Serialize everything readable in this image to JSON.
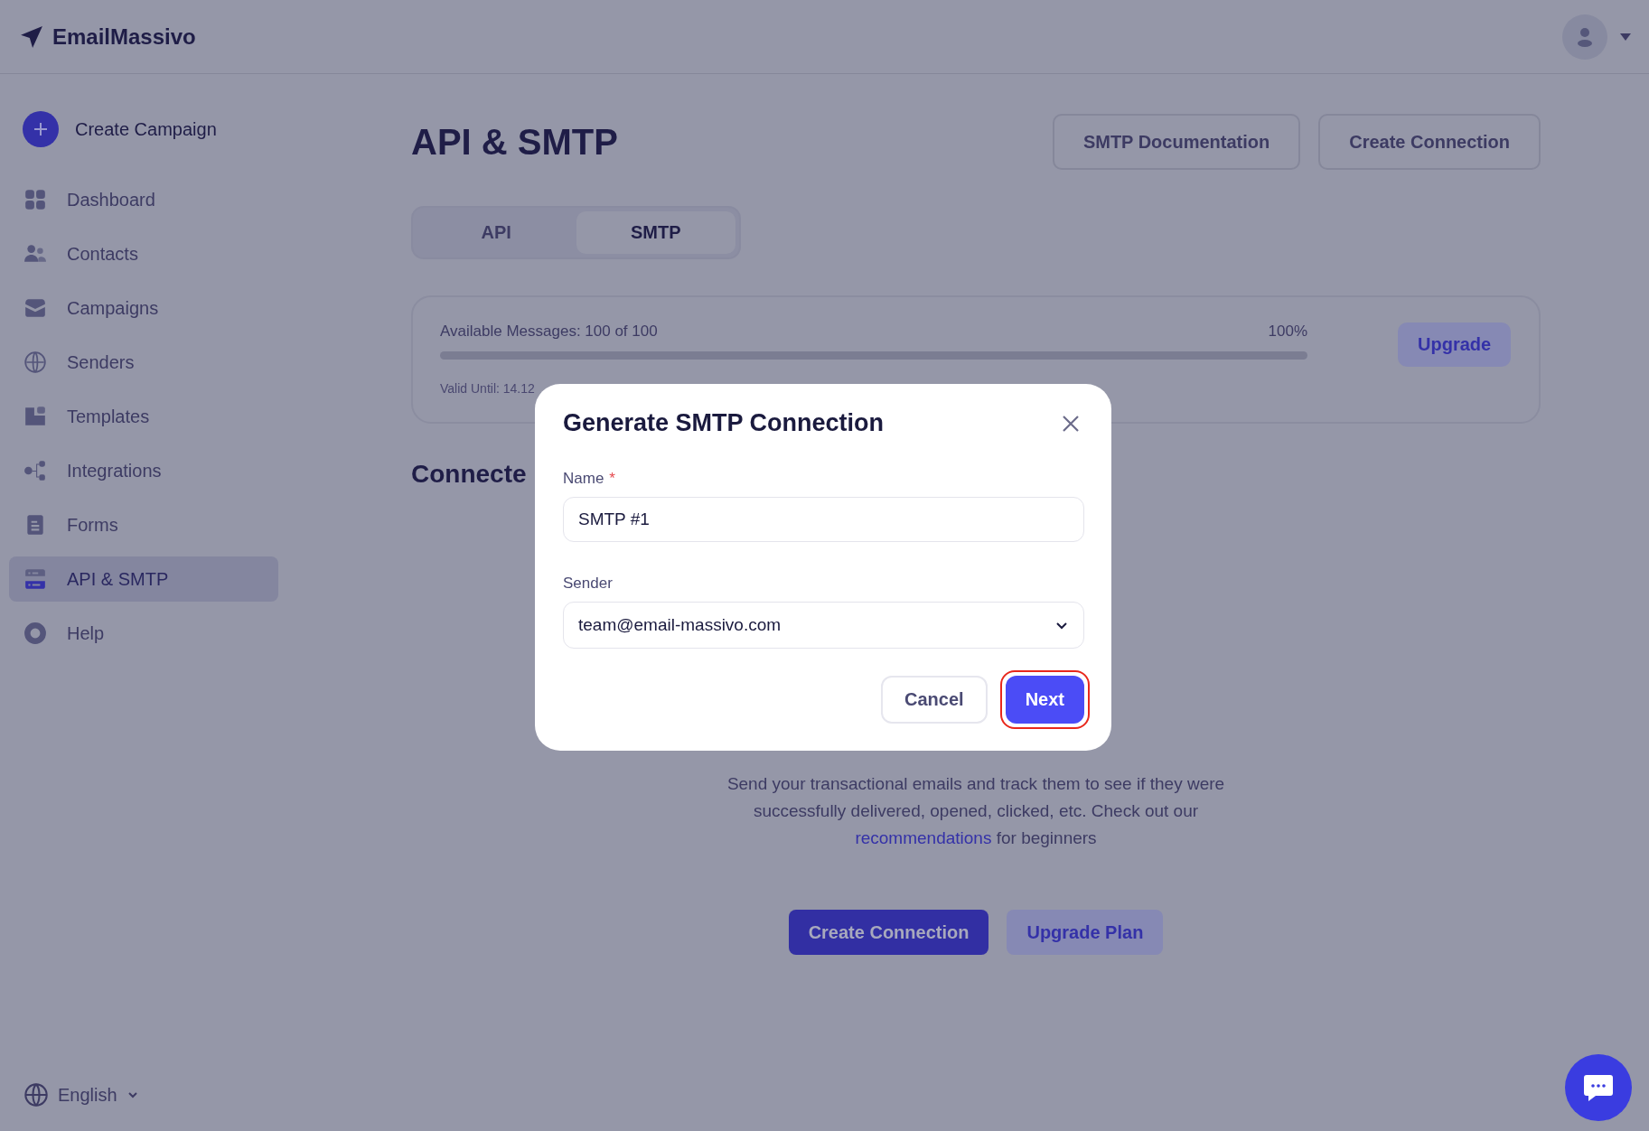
{
  "brand": {
    "name": "EmailMassivo"
  },
  "sidebar": {
    "create_button": "Create Campaign",
    "items": [
      {
        "label": "Dashboard",
        "selected": false
      },
      {
        "label": "Contacts",
        "selected": false
      },
      {
        "label": "Campaigns",
        "selected": false
      },
      {
        "label": "Senders",
        "selected": false
      },
      {
        "label": "Templates",
        "selected": false
      },
      {
        "label": "Integrations",
        "selected": false
      },
      {
        "label": "Forms",
        "selected": false
      },
      {
        "label": "API & SMTP",
        "selected": true
      },
      {
        "label": "Help",
        "selected": false
      }
    ],
    "language": "English"
  },
  "page": {
    "title": "API & SMTP",
    "header_buttons": [
      "SMTP Documentation",
      "Create Connection"
    ],
    "tabs": [
      {
        "label": "API",
        "selected": false
      },
      {
        "label": "SMTP",
        "selected": true
      }
    ],
    "usage": {
      "label": "Available Messages: 100 of 100",
      "percent": "100%",
      "level": 1,
      "valid_until": "Valid Until: 14.12",
      "button": "Upgrade"
    },
    "section_heading": "Connecte",
    "empty_state": {
      "text": "Send your transactional emails and track them to see if they were successfully delivered, opened, clicked, etc. Check out our",
      "link": "recommendations",
      "after": "for beginners",
      "buttons": [
        {
          "label": "Create Connection",
          "kind": "primary"
        },
        {
          "label": "Upgrade Plan",
          "kind": "secondary"
        }
      ]
    }
  },
  "modal": {
    "title": "Generate SMTP Connection",
    "fields": [
      {
        "label": "Name",
        "required_mark": "*",
        "kind": "text",
        "value": "SMTP #1"
      },
      {
        "label": "Sender",
        "kind": "select",
        "value": "team@email-massivo.com"
      }
    ],
    "buttons": [
      {
        "label": "Cancel",
        "kind": "secondary",
        "highlighted": false
      },
      {
        "label": "Next",
        "kind": "primary",
        "highlighted": true
      }
    ]
  }
}
